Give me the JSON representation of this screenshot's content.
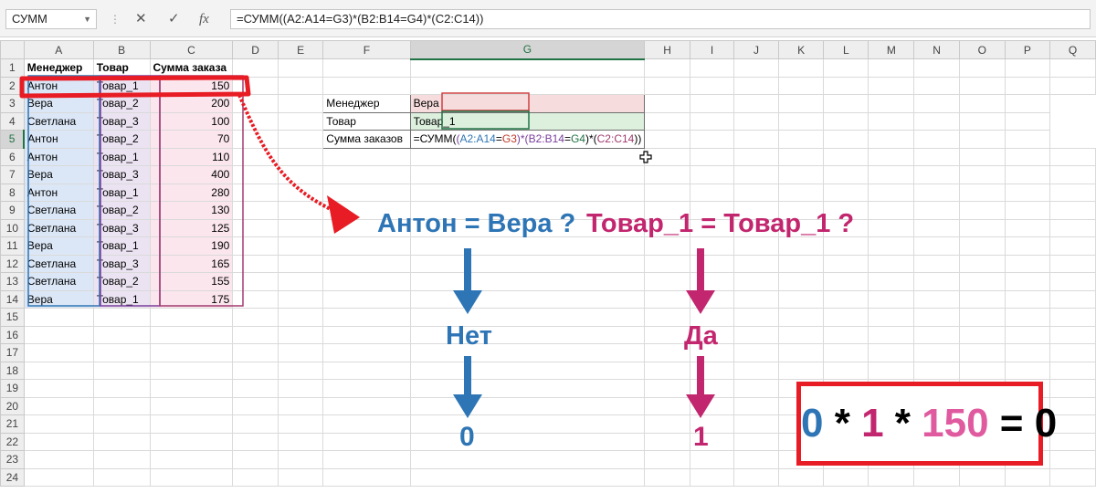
{
  "formula_bar": {
    "name_box": "СУММ",
    "cancel_icon": "✕",
    "confirm_icon": "✓",
    "fx_label": "fx",
    "formula": "=СУММ((A2:A14=G3)*(B2:B14=G4)*(C2:C14))"
  },
  "sheet": {
    "columns": [
      "A",
      "B",
      "C",
      "D",
      "E",
      "F",
      "G",
      "H",
      "I",
      "J",
      "K",
      "L",
      "M",
      "N",
      "O",
      "P",
      "Q"
    ],
    "headers": {
      "manager": "Менеджер",
      "product": "Товар",
      "sum": "Сумма заказа"
    },
    "rows": [
      {
        "manager": "Антон",
        "product": "Товар_1",
        "sum": "150"
      },
      {
        "manager": "Вера",
        "product": "Товар_2",
        "sum": "200"
      },
      {
        "manager": "Светлана",
        "product": "Товар_3",
        "sum": "100"
      },
      {
        "manager": "Антон",
        "product": "Товар_2",
        "sum": "70"
      },
      {
        "manager": "Антон",
        "product": "Товар_1",
        "sum": "110"
      },
      {
        "manager": "Вера",
        "product": "Товар_3",
        "sum": "400"
      },
      {
        "manager": "Антон",
        "product": "Товар_1",
        "sum": "280"
      },
      {
        "manager": "Светлана",
        "product": "Товар_2",
        "sum": "130"
      },
      {
        "manager": "Светлана",
        "product": "Товар_3",
        "sum": "125"
      },
      {
        "manager": "Вера",
        "product": "Товар_1",
        "sum": "190"
      },
      {
        "manager": "Светлана",
        "product": "Товар_3",
        "sum": "165"
      },
      {
        "manager": "Светлана",
        "product": "Товар_2",
        "sum": "155"
      },
      {
        "manager": "Вера",
        "product": "Товар_1",
        "sum": "175"
      }
    ],
    "criteria": {
      "manager_label": "Менеджер",
      "manager_value": "Вера",
      "product_label": "Товар",
      "product_value": "Товар_1",
      "sum_label": "Сумма заказов"
    },
    "formula_parts": {
      "p0": "=СУММ(",
      "p1": "(",
      "p2": "A2:A14",
      "p3": "=",
      "p4": "G3",
      "p5": ")*(",
      "p6": "B2:B14",
      "p7": "=",
      "p8": "G4",
      "p9": ")*(",
      "p10": "C2:C14",
      "p11": "))"
    }
  },
  "annotations": {
    "q1": "Антон = Вера ?",
    "q2": "Товар_1 = Товар_1 ?",
    "a1": "Нет",
    "a2": "Да",
    "v1": "0",
    "v2": "1",
    "result": {
      "t0": "0",
      "t1": " * ",
      "t2": "1",
      "t3": " * ",
      "t4": "150",
      "t5": " = ",
      "t6": "0"
    }
  },
  "colors": {
    "blue": "#2e75b6",
    "magenta": "#c2266e",
    "pink": "#e05aa0",
    "red": "#e81c24",
    "excel_green": "#217346"
  }
}
